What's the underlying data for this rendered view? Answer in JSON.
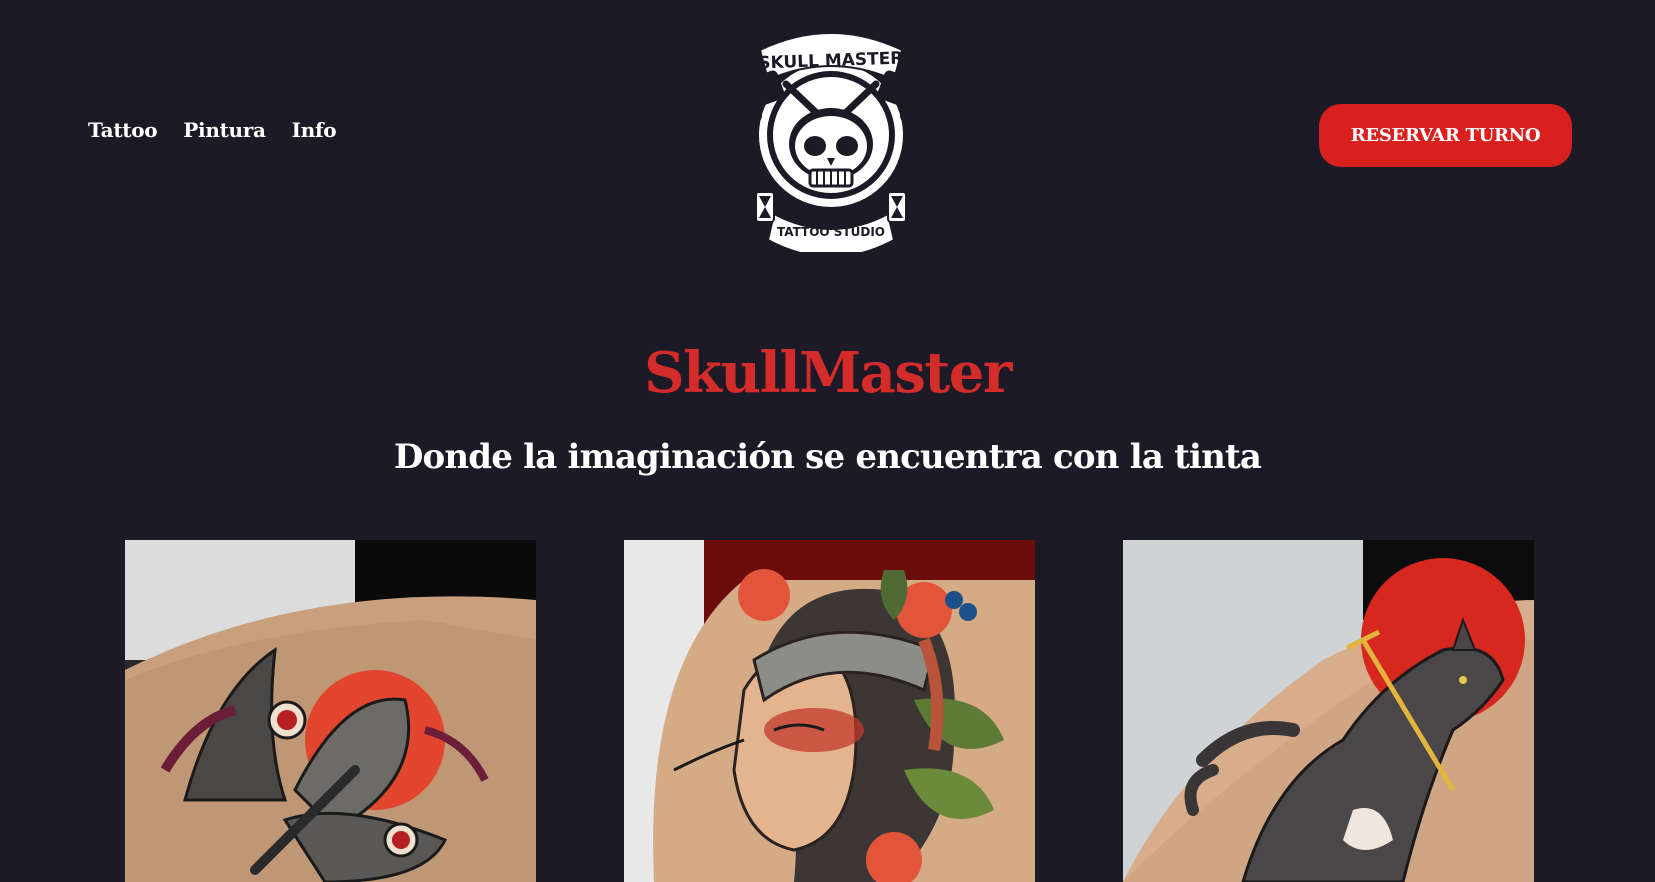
{
  "nav": {
    "items": [
      "Tattoo",
      "Pintura",
      "Info"
    ]
  },
  "logo": {
    "top_text": "SKULL MASTER",
    "bottom_text": "TATTOO STUDIO"
  },
  "cta": {
    "label": "RESERVAR TURNO"
  },
  "hero": {
    "title": "SkullMaster",
    "subtitle": "Donde la imaginación se encuentra con la tinta"
  },
  "gallery": [
    {
      "subject": "moth-tattoo"
    },
    {
      "subject": "woman-portrait-tattoo"
    },
    {
      "subject": "wolf-dagger-tattoo"
    }
  ],
  "colors": {
    "background": "#1b1a26",
    "accent": "#d8211f",
    "title": "#d42b2b",
    "text": "#ffffff"
  }
}
